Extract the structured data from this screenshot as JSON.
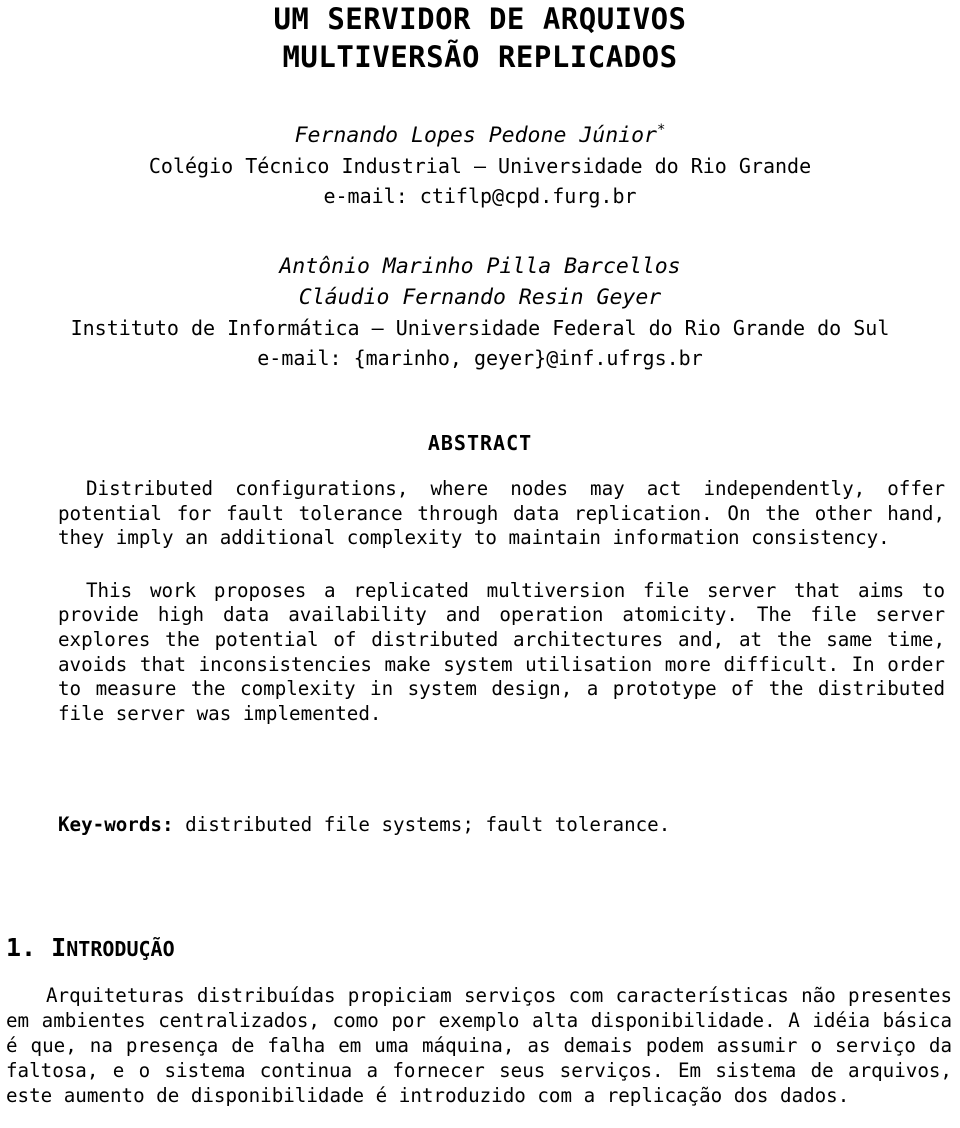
{
  "title": {
    "line1": "UM SERVIDOR DE ARQUIVOS",
    "line2": "MULTIVERSÃO REPLICADOS"
  },
  "authors": [
    {
      "name": "Fernando Lopes Pedone Júnior",
      "name_marker": "*",
      "affiliation": "Colégio Técnico Industrial – Universidade do Rio Grande",
      "email": "e-mail: ctiflp@cpd.furg.br"
    },
    {
      "name": "Antônio Marinho Pilla Barcellos",
      "name2": "Cláudio Fernando Resin Geyer",
      "affiliation": "Instituto de Informática – Universidade Federal do Rio Grande do Sul",
      "email": "e-mail: {marinho, geyer}@inf.ufrgs.br"
    }
  ],
  "abstract": {
    "heading": "ABSTRACT",
    "paragraph1": "Distributed configurations, where nodes may act independently, offer potential for fault tolerance through data replication. On the other hand, they imply an additional complexity to maintain information consistency.",
    "paragraph2": "This work proposes a replicated multiversion file server that aims to provide high data availability and operation atomicity. The file server explores the potential of distributed architectures and, at the same time, avoids that inconsistencies make system utilisation more difficult. In order to measure the complexity in system design, a prototype of the distributed file server was implemented."
  },
  "keywords": {
    "label": "Key-words:",
    "value": "distributed file systems; fault tolerance."
  },
  "section": {
    "number": "1.",
    "title_first": "I",
    "title_rest": "NTRODUÇÃO",
    "paragraph1": "Arquiteturas distribuídas propiciam serviços com características não presentes em ambientes centralizados, como por exemplo alta disponibilidade. A idéia básica é que, na presença de falha em uma máquina, as demais podem assumir o serviço da faltosa, e o sistema continua a fornecer seus serviços. Em sistema de arquivos, este aumento de disponibilidade é introduzido com a replicação dos dados."
  },
  "colors": {
    "page_background": "#ffffff",
    "text": "#000000"
  }
}
